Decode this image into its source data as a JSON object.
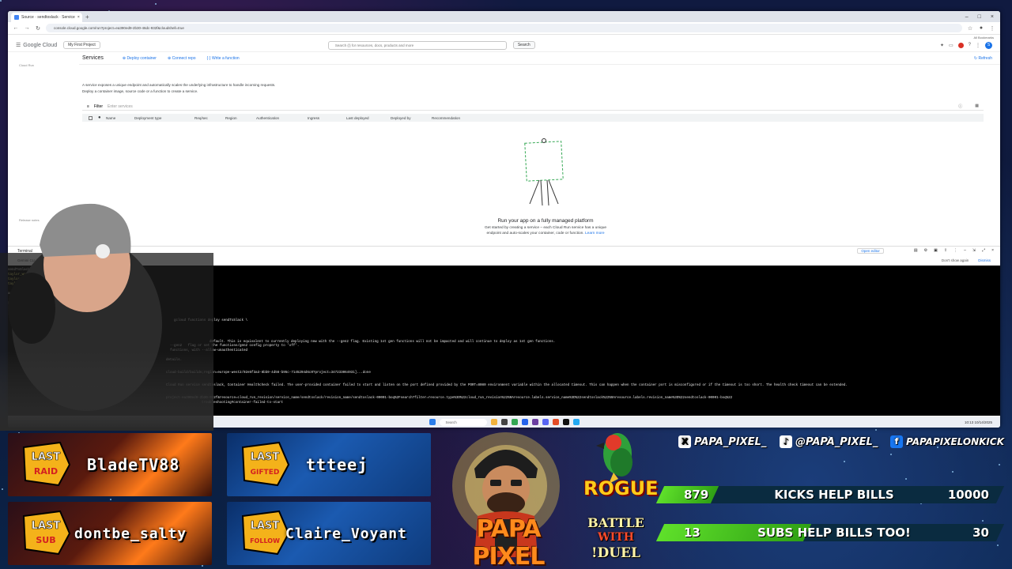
{
  "browser": {
    "tab_title": "Source · sendtoslack · Service",
    "url": "console.cloud.google.com/run?project=ea390ed9-2b30-46dc-932f&cloudshell=true",
    "bookmarks_label": "All Bookmarks"
  },
  "gcp": {
    "logo": "Google Cloud",
    "project": "My First Project",
    "search_placeholder": "Search (/) for resources, docs, products and more",
    "search_button": "Search",
    "avatar_letter": "S",
    "page_title": "Services",
    "toolbar": [
      "Deploy container",
      "Connect repo",
      "Write a function"
    ],
    "refresh": "Refresh",
    "description": [
      "A service exposes a unique endpoint and automatically scales the underlying infrastructure to handle incoming requests.",
      "Deploy a container image, source code or a function to create a service."
    ],
    "filter_label": "Filter",
    "filter_placeholder": "Enter services",
    "columns": [
      "Name",
      "Deployment type",
      "Req/sec",
      "Region",
      "Authentication",
      "Ingress",
      "Last deployed",
      "Deployed by",
      "Recommendation"
    ],
    "sidebar_links": [
      "Cloud Run",
      "Release notes"
    ],
    "empty_title": "Run your app on a fully managed platform",
    "empty_body_1": "Get started by creating a service – each Cloud Run service has a unique",
    "empty_body_2": "endpoint and auto-scales your container, code or function.",
    "learn_more": "Learn more"
  },
  "terminal": {
    "tab": "Terminal",
    "open_editor": "Open editor",
    "gemini_notice": "Gemini CLI is available... to try it",
    "gemini_learn": "Learn more",
    "dont_show": "Don't show again",
    "dismiss": "Dismiss",
    "lines": [
      "sendToSlack",
      "taylor_work_68@cloudshell:~ (ea390ed9-2b30-46dc-932f)$ nano index.js",
      "taylor_work_68@cloudshell:~ (ea390ed9-2b30-46dc-932f)$ nano package.json",
      "taylor_work_68@cloudshell:~ (ea390ed9-2b30-46dc-932f)$ npm install",
      "added 78 packages",
      "packages",
      "run `npm fund`",
      "gcloud functions deploy sendToSlack \\",
      "  --gen2   flag or set the functions/gen2 config property to 'off'.",
      "default. This is equivalent to currently deploying new with the --gen2 flag. Existing 1st gen functions will not be impacted and will continue to deploy as 1st gen functions.",
      "  functions, with --allow-unauthenticated",
      "details.",
      "cloud-build/builds;region=europe-west2/92e5f3a3-8bb9-4d56-b95c-7145294d6c0?project=347233064931]...done",
      "Cloud Run service sendtoslack, Container Healthcheck failed. The user-provided container failed to start and listen on the port defined provided by the PORT=8080 environment variable within the allocated timeout. This can happen when the container port is misconfigured or if the timeout is too short. The health check timeout can be extended.",
      "project-ea390ed9-2b30-932f&resource=cloud_run_revision/service_name/sendtoslack/revision_name/sendtoslack-00001-boq%2Fsearch?filter=resource.type%3D%22cloud_run_revision%22%0Aresource.labels.service_name%3D%22sendtoslack%22%0Aresource.labels.revision_name%3D%22sendtoslack-00001-boq%22",
      "troubleshooting#container-failed-to-start"
    ]
  },
  "taskbar": {
    "search": "Search",
    "time": "10:13",
    "date": "10/14/2025"
  },
  "overlay": {
    "panels": [
      {
        "badge_top": "LAST",
        "badge_bottom": "RAID",
        "name": "BladeTV88"
      },
      {
        "badge_top": "LAST",
        "badge_bottom": "GIFTED",
        "name": "ttteej"
      },
      {
        "badge_top": "LAST",
        "badge_bottom": "SUB",
        "name": "dontbe_salty"
      },
      {
        "badge_top": "LAST",
        "badge_bottom": "FOLLOW",
        "name": "Claire_Voyant"
      }
    ],
    "logo_text": "PAPA PIXEL",
    "rogue": "ROGUE",
    "battle": [
      "BATTLE",
      "WITH",
      "!DUEL"
    ],
    "social": [
      {
        "icon": "X",
        "handle": "PAPA_PIXEL_"
      },
      {
        "icon": "♪",
        "handle": "@PAPA_PIXEL_"
      },
      {
        "icon": "f",
        "handle": "PAPAPIXELONKICK"
      }
    ],
    "goals": [
      {
        "current": "879",
        "label": "KICKS HELP BILLS",
        "target": "10000",
        "progress": 0.0879
      },
      {
        "current": "13",
        "label": "SUBS HELP BILLS TOO!",
        "target": "30",
        "progress": 0.4333
      }
    ],
    "colors": {
      "goal_fill": "#5fe02a",
      "accent": "#ff8a1c",
      "gcp_blue": "#1a73e8"
    }
  }
}
